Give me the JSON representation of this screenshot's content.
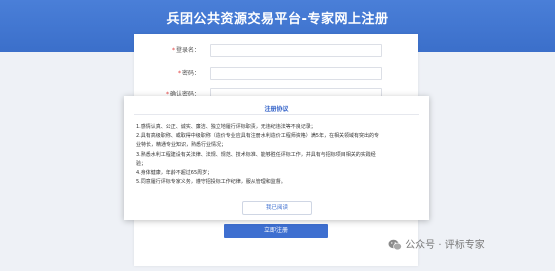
{
  "page": {
    "title": "兵团公共资源交易平台-专家网上注册"
  },
  "form": {
    "fields": [
      {
        "label": "登录名：",
        "required": "*"
      },
      {
        "label": "密码：",
        "required": "*"
      },
      {
        "label": "确认密码：",
        "required": "*"
      }
    ],
    "submit_label": "立即注册"
  },
  "modal": {
    "title": "注册协议",
    "terms": [
      "1.感情认真、公正、诚实、廉洁、独立地履行评标职责，无违纪违法等不良记录；",
      "2.具有高级职称、或取得中级职称（造价专业应具有注册水利造价工程师资格）满5年，在相关领域有突出的专",
      "业特长，精通专业知识，熟悉行业情况；",
      "3.熟悉水利工程建设有关法律、法规、规范、技术标准、能够胜任评标工作，并具有与招标项目相关的实践经",
      "验；",
      "4.身体健康，年龄不超过65周岁；",
      "5.同意履行评标专家义务，遵守招投标工作纪律，服从管理和监督。"
    ],
    "close_label": "我已阅读"
  },
  "watermark": {
    "text": "公众号 · 评标专家",
    "icon": "wechat-icon"
  },
  "colors": {
    "header": "#3b6fca",
    "accent": "#3e6fd0",
    "required": "#e23b3b"
  }
}
